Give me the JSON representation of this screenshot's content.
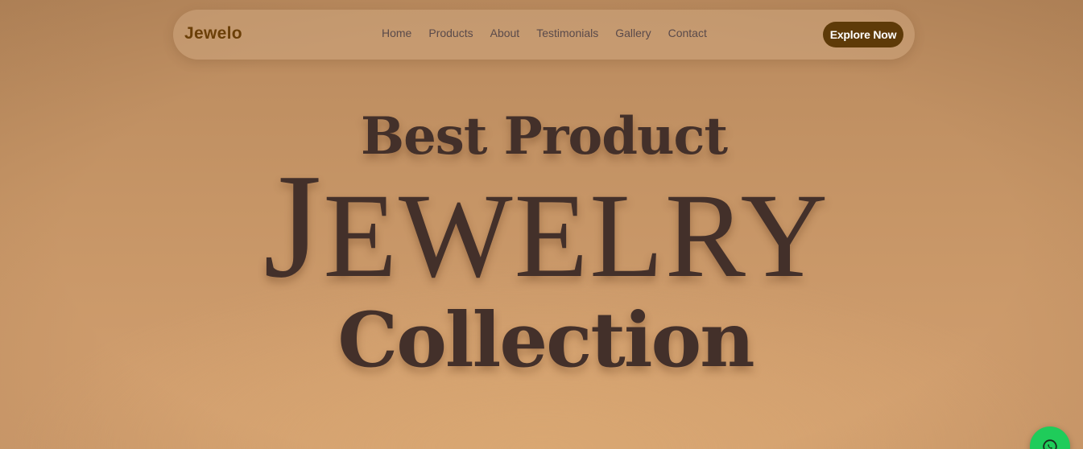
{
  "navbar": {
    "brand": "Jewelo",
    "links": [
      "Home",
      "Products",
      "About",
      "Testimonials",
      "Gallery",
      "Contact"
    ],
    "cta_label": "Explore Now"
  },
  "hero": {
    "line1": "Best Product",
    "line2_initial": "J",
    "line2_rest": "EWELRY",
    "line3": "Collection"
  },
  "floating": {
    "icon": "whatsapp-icon",
    "color": "#1fcc5a"
  },
  "colors": {
    "brand": "#6b3f08",
    "cta_background": "#5e3a08",
    "hero_text": "#43302a",
    "nav_link": "#5a4a4a"
  }
}
